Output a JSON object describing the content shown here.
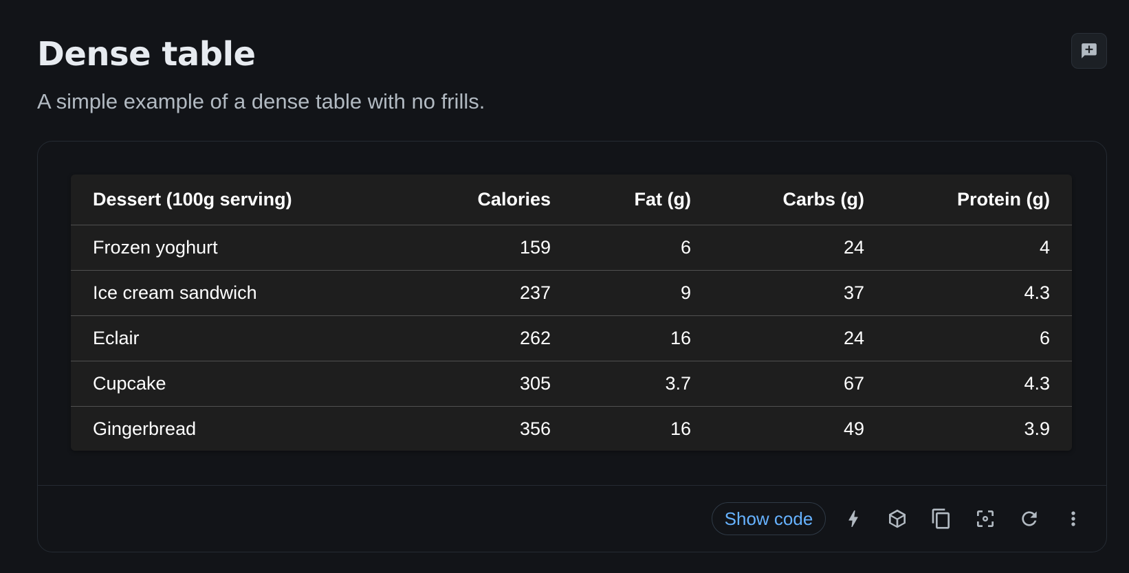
{
  "header": {
    "title": "Dense table",
    "subtitle": "A simple example of a dense table with no frills."
  },
  "icons": {
    "feedback": "add-comment-icon",
    "toolbar": [
      "bolt-icon",
      "cube-icon",
      "copy-icon",
      "screenshot-icon",
      "refresh-icon",
      "more-vert-icon"
    ]
  },
  "table": {
    "columns": [
      "Dessert (100g serving)",
      "Calories",
      "Fat (g)",
      "Carbs (g)",
      "Protein (g)"
    ],
    "rows": [
      [
        "Frozen yoghurt",
        "159",
        "6",
        "24",
        "4"
      ],
      [
        "Ice cream sandwich",
        "237",
        "9",
        "37",
        "4.3"
      ],
      [
        "Eclair",
        "262",
        "16",
        "24",
        "6"
      ],
      [
        "Cupcake",
        "305",
        "3.7",
        "67",
        "4.3"
      ],
      [
        "Gingerbread",
        "356",
        "16",
        "49",
        "3.9"
      ]
    ]
  },
  "toolbar": {
    "show_code_label": "Show code"
  },
  "colors": {
    "background": "#121418",
    "table_background": "#1e1e1e",
    "accent": "#66b2ff",
    "text": "#ffffff",
    "muted_text": "#b2bac2"
  }
}
